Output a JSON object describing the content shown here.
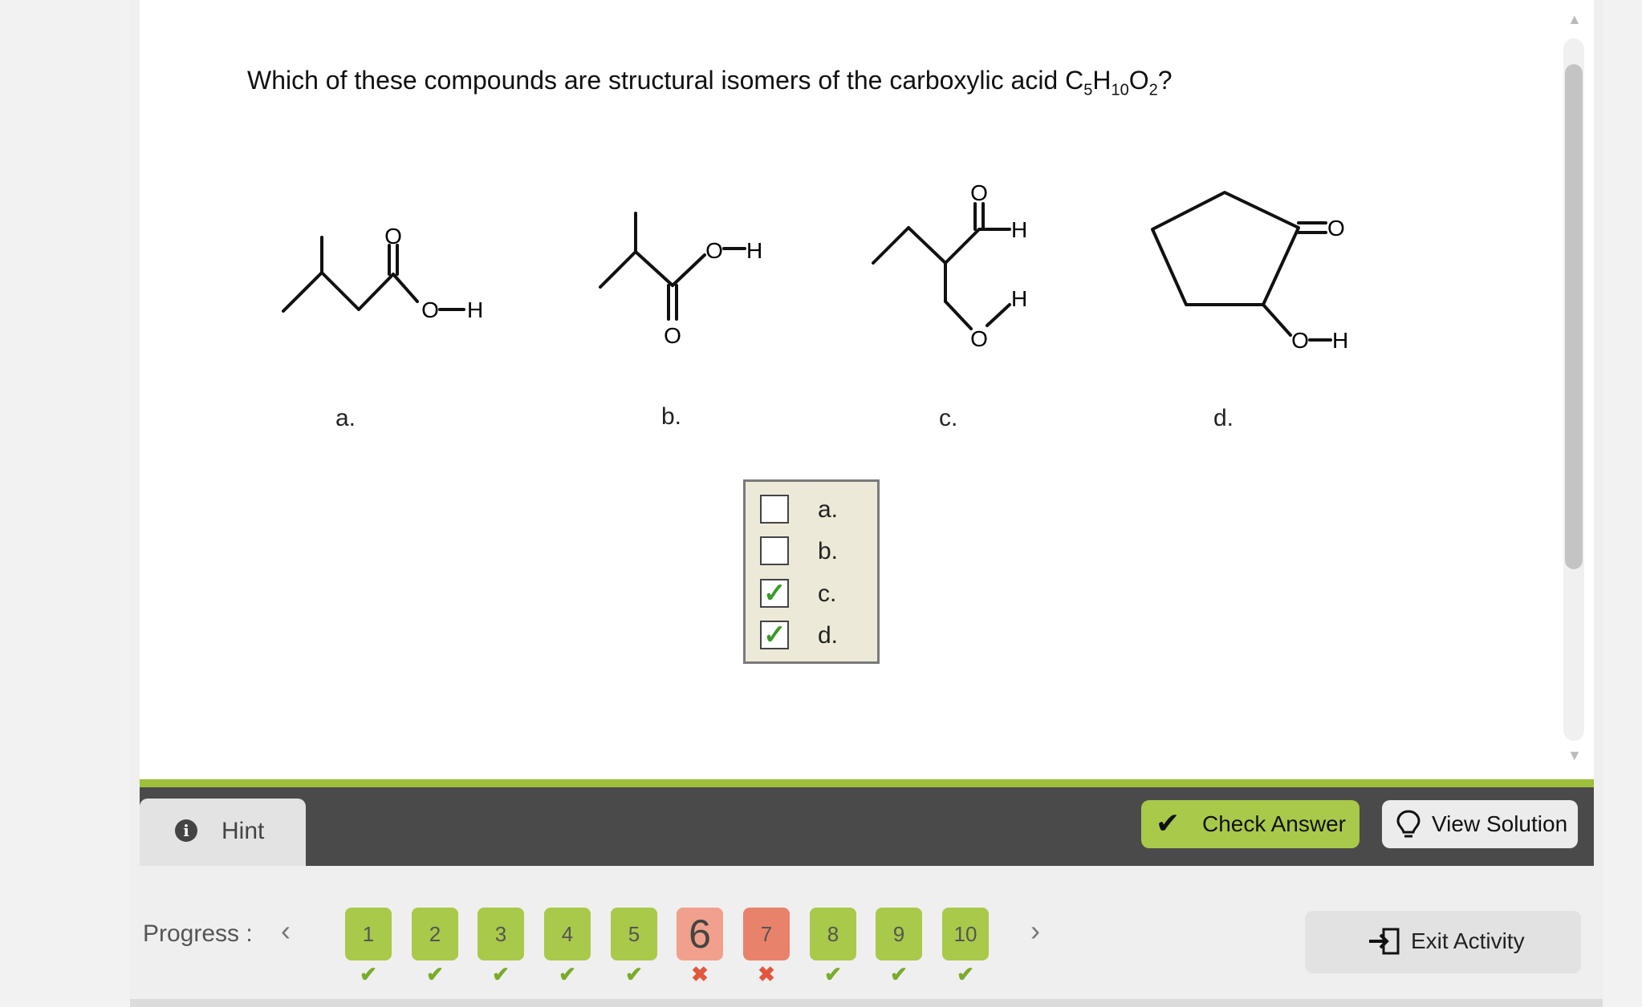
{
  "question": {
    "text_before": "Which of these compounds are structural isomers of the carboxylic acid C",
    "sub1": "5",
    "h": "H",
    "sub2": "10",
    "o": "O",
    "sub3": "2",
    "end": "?"
  },
  "structures": {
    "atom_O": "O",
    "atom_H": "H",
    "group_OH": "O—H",
    "group_dO": "=O"
  },
  "structure_labels": [
    "a.",
    "b.",
    "c.",
    "d."
  ],
  "answer_choices": [
    {
      "label": "a.",
      "checked": false
    },
    {
      "label": "b.",
      "checked": false
    },
    {
      "label": "c.",
      "checked": true
    },
    {
      "label": "d.",
      "checked": true
    }
  ],
  "check_mark": "✓",
  "toolbar": {
    "hint": "Hint",
    "hint_icon": "i",
    "check_answer": "Check Answer",
    "check_icon": "✔",
    "view_solution": "View Solution"
  },
  "progress": {
    "label": "Progress :",
    "prev": "‹",
    "next": "›",
    "items": [
      {
        "n": "1",
        "status": "correct",
        "mark": "✔"
      },
      {
        "n": "2",
        "status": "correct",
        "mark": "✔"
      },
      {
        "n": "3",
        "status": "correct",
        "mark": "✔"
      },
      {
        "n": "4",
        "status": "correct",
        "mark": "✔"
      },
      {
        "n": "5",
        "status": "correct",
        "mark": "✔"
      },
      {
        "n": "6",
        "status": "current-incorrect",
        "mark": "✖"
      },
      {
        "n": "7",
        "status": "incorrect",
        "mark": "✖"
      },
      {
        "n": "8",
        "status": "correct",
        "mark": "✔"
      },
      {
        "n": "9",
        "status": "correct",
        "mark": "✔"
      },
      {
        "n": "10",
        "status": "correct",
        "mark": "✔"
      }
    ]
  },
  "exit": {
    "label": "Exit Activity"
  },
  "colors": {
    "accent_green": "#a9c94a",
    "incorrect_red": "#e9826a",
    "toolbar": "#4a4a4a"
  }
}
